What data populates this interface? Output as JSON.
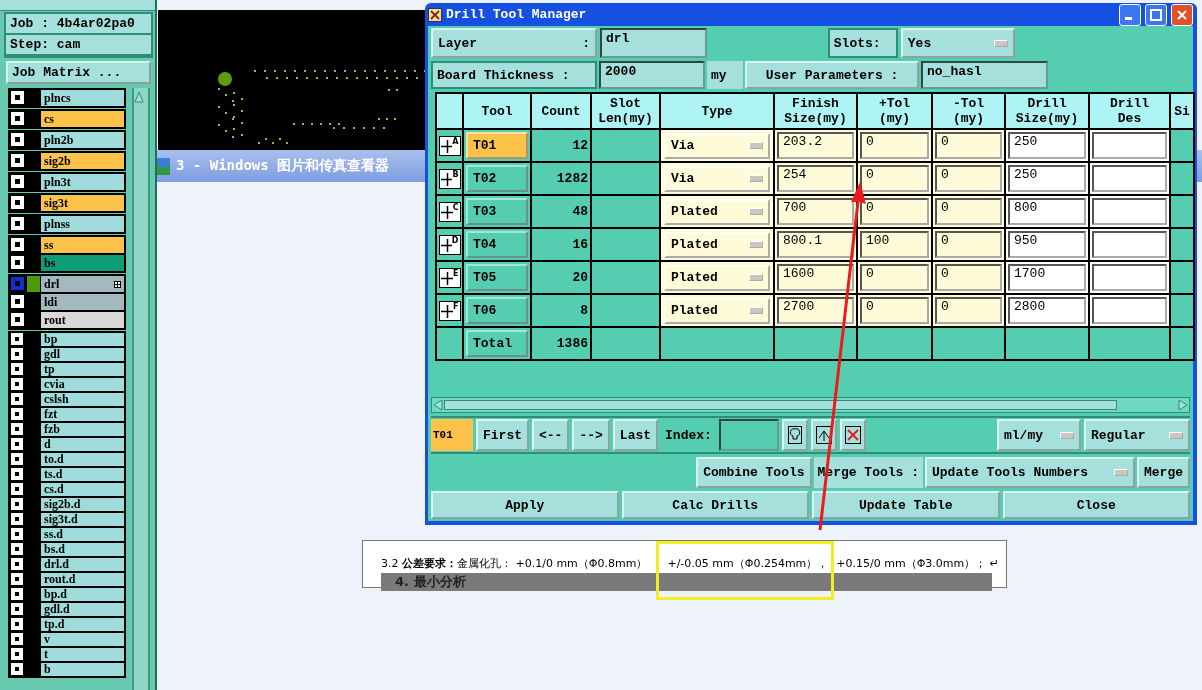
{
  "job_panel": {
    "job": "Job : 4b4ar02pa0",
    "step": "Step: cam",
    "matrix_button": "Job Matrix ..."
  },
  "layer_groups": [
    {
      "layers": [
        {
          "name": "plncs",
          "color": "#a0dcdc",
          "selected": false,
          "checked": true
        }
      ]
    },
    {
      "layers": [
        {
          "name": "cs",
          "color": "#fcc24a",
          "selected": false,
          "checked": true
        }
      ]
    },
    {
      "layers": [
        {
          "name": "pln2b",
          "color": "#a0dcdc",
          "selected": false,
          "checked": true
        }
      ]
    },
    {
      "layers": [
        {
          "name": "sig2b",
          "color": "#fcc24a",
          "selected": false,
          "checked": true
        }
      ]
    },
    {
      "layers": [
        {
          "name": "pln3t",
          "color": "#a0dcdc",
          "selected": false,
          "checked": true
        }
      ]
    },
    {
      "layers": [
        {
          "name": "sig3t",
          "color": "#fcc24a",
          "selected": false,
          "checked": true
        }
      ]
    },
    {
      "layers": [
        {
          "name": "plnss",
          "color": "#a0dcdc",
          "selected": false,
          "checked": true
        }
      ]
    },
    {
      "layers": [
        {
          "name": "ss",
          "color": "#fcc24a",
          "selected": false,
          "checked": true
        },
        {
          "name": "bs",
          "color": "#0d9e78",
          "selected": false,
          "checked": true
        }
      ]
    },
    {
      "layers": [
        {
          "name": "drl",
          "color": "#a4b8bf",
          "selected": true,
          "checked": true
        },
        {
          "name": "ldi",
          "color": "#a4b8bf",
          "selected": false,
          "checked": true
        },
        {
          "name": "rout",
          "color": "#d8d8d8",
          "selected": false,
          "checked": true
        }
      ]
    },
    {
      "layers": [
        {
          "name": "bp",
          "color": "#a0dcdc",
          "selected": false,
          "checked": true
        },
        {
          "name": "gdl",
          "color": "#a0dcdc",
          "selected": false,
          "checked": true
        },
        {
          "name": "tp",
          "color": "#a0dcdc",
          "selected": false,
          "checked": true
        },
        {
          "name": "cvia",
          "color": "#a0dcdc",
          "selected": false,
          "checked": true
        },
        {
          "name": "cslsh",
          "color": "#a0dcdc",
          "selected": false,
          "checked": true
        },
        {
          "name": "fzt",
          "color": "#a0dcdc",
          "selected": false,
          "checked": true
        },
        {
          "name": "fzb",
          "color": "#a0dcdc",
          "selected": false,
          "checked": true
        },
        {
          "name": "d",
          "color": "#a0dcdc",
          "selected": false,
          "checked": true
        },
        {
          "name": "to.d",
          "color": "#a0dcdc",
          "selected": false,
          "checked": true
        },
        {
          "name": "ts.d",
          "color": "#a0dcdc",
          "selected": false,
          "checked": true
        },
        {
          "name": "cs.d",
          "color": "#a0dcdc",
          "selected": false,
          "checked": true
        },
        {
          "name": "sig2b.d",
          "color": "#a0dcdc",
          "selected": false,
          "checked": true
        },
        {
          "name": "sig3t.d",
          "color": "#a0dcdc",
          "selected": false,
          "checked": true
        },
        {
          "name": "ss.d",
          "color": "#a0dcdc",
          "selected": false,
          "checked": true
        },
        {
          "name": "bs.d",
          "color": "#a0dcdc",
          "selected": false,
          "checked": true
        },
        {
          "name": "drl.d",
          "color": "#a0dcdc",
          "selected": false,
          "checked": true
        },
        {
          "name": "rout.d",
          "color": "#a0dcdc",
          "selected": false,
          "checked": true
        },
        {
          "name": "bp.d",
          "color": "#a0dcdc",
          "selected": false,
          "checked": true
        },
        {
          "name": "gdl.d",
          "color": "#a0dcdc",
          "selected": false,
          "checked": true
        },
        {
          "name": "tp.d",
          "color": "#a0dcdc",
          "selected": false,
          "checked": true
        },
        {
          "name": "v",
          "color": "#a0dcdc",
          "selected": false,
          "checked": true
        },
        {
          "name": "t",
          "color": "#a0dcdc",
          "selected": false,
          "checked": true
        },
        {
          "name": "b",
          "color": "#a0dcdc",
          "selected": false,
          "checked": true
        }
      ]
    }
  ],
  "viewer_window": {
    "title": "3 - Windows 图片和传真查看器"
  },
  "document": {
    "segments": [
      {
        "text": "3.2 **公差要求：**金属化孔：  +0.1/0 mm（Φ0.8mm）",
        "highlighted": false
      },
      {
        "text": "+/-0.05 mm（Φ0.254mm），",
        "highlighted": true
      },
      {
        "text": "+0.15/0 mm（Φ3.0mm）；  ↵",
        "highlighted": false
      }
    ],
    "next_heading": "4. 最小分析"
  },
  "drill_window": {
    "title": "Drill Tool Manager",
    "layer_label": "Layer",
    "layer_colon": ":",
    "layer_value": "drl",
    "slots_label": "Slots:",
    "slots_value": "Yes",
    "thickness_label": "Board Thickness :",
    "thickness_value": "2000",
    "thickness_unit": "my",
    "user_params_button": "User Parameters :",
    "user_params_value": "no_hasl"
  },
  "table": {
    "columns": [
      "Tool",
      "Count",
      "Slot\nLen(my)",
      "Type",
      "Finish\nSize(my)",
      "+Tol\n(my)",
      "-Tol\n(my)",
      "Drill\nSize(my)",
      "Drill\nDes",
      "Si"
    ],
    "rows": [
      {
        "mark": "A",
        "tool": "T01",
        "selected": true,
        "count": "12",
        "type": "Via",
        "finish_size": "203.2",
        "plus_tol": "0",
        "minus_tol": "0",
        "drill_size": "250"
      },
      {
        "mark": "B",
        "tool": "T02",
        "selected": false,
        "count": "1282",
        "type": "Via",
        "finish_size": "254",
        "plus_tol": "0",
        "minus_tol": "0",
        "drill_size": "250"
      },
      {
        "mark": "C",
        "tool": "T03",
        "selected": false,
        "count": "48",
        "type": "Plated",
        "finish_size": "700",
        "plus_tol": "0",
        "minus_tol": "0",
        "drill_size": "800"
      },
      {
        "mark": "D",
        "tool": "T04",
        "selected": false,
        "count": "16",
        "type": "Plated",
        "finish_size": "800.1",
        "plus_tol": "100",
        "minus_tol": "0",
        "drill_size": "950"
      },
      {
        "mark": "E",
        "tool": "T05",
        "selected": false,
        "count": "20",
        "type": "Plated",
        "finish_size": "1600",
        "plus_tol": "0",
        "minus_tol": "0",
        "drill_size": "1700"
      },
      {
        "mark": "F",
        "tool": "T06",
        "selected": false,
        "count": "8",
        "type": "Plated",
        "finish_size": "2700",
        "plus_tol": "0",
        "minus_tol": "0",
        "drill_size": "2800"
      }
    ],
    "total": {
      "label": "Total",
      "count": "1386"
    }
  },
  "toolbar": {
    "current_tool": "T01",
    "nav_buttons": [
      "First",
      "<--",
      "-->",
      "Last"
    ],
    "index_label": "Index:",
    "units": "ml/my",
    "mode": "Regular"
  },
  "merge_row": {
    "combine_button": "Combine Tools",
    "merge_label": "Merge Tools :",
    "merge_option": "Update Tools Numbers",
    "merge_button": "Merge"
  },
  "buttons": [
    "Apply",
    "Calc Drills",
    "Update Table",
    "Close"
  ]
}
